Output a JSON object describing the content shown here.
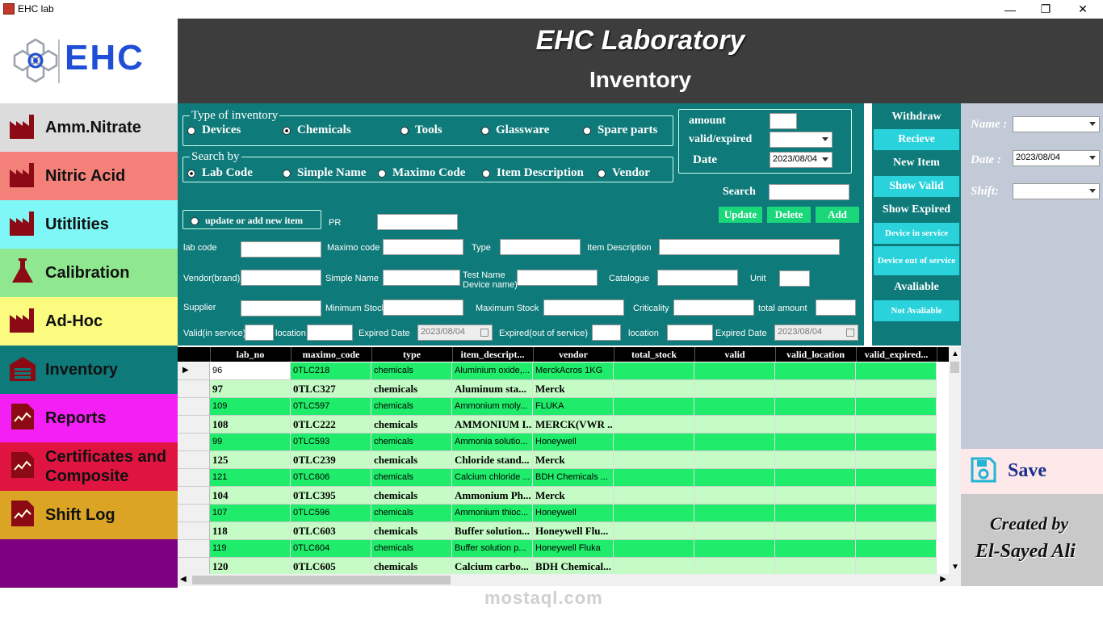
{
  "window": {
    "title": "EHC lab",
    "min": "—",
    "max": "❐",
    "close": "✕"
  },
  "logo": {
    "text": "EHC"
  },
  "sidebar": [
    {
      "label": "Amm.Nitrate",
      "bg": "#dcdcdc",
      "icon": "factory-icon"
    },
    {
      "label": "Nitric Acid",
      "bg": "#f4807a",
      "icon": "factory-icon"
    },
    {
      "label": "Utitlities",
      "bg": "#7ff7f7",
      "icon": "factory-icon"
    },
    {
      "label": "Calibration",
      "bg": "#8fe88f",
      "icon": "flask-icon"
    },
    {
      "label": "Ad-Hoc",
      "bg": "#fbfb80",
      "icon": "factory-icon"
    },
    {
      "label": "Inventory",
      "bg": "#0f7a7a",
      "icon": "warehouse-icon"
    },
    {
      "label": "Reports",
      "bg": "#f41ff4",
      "icon": "report-icon"
    },
    {
      "label": "Certificates and Composite",
      "bg": "#df1440",
      "icon": "report-icon"
    },
    {
      "label": "Shift Log",
      "bg": "#dba424",
      "icon": "report-icon"
    },
    {
      "label": "",
      "bg": "#7d0080",
      "icon": ""
    }
  ],
  "header": {
    "title": "EHC Laboratory",
    "subtitle": "Inventory"
  },
  "type_group": {
    "label": "Type of inventory",
    "options": [
      {
        "label": "Devices",
        "checked": false
      },
      {
        "label": "Chemicals",
        "checked": true
      },
      {
        "label": "Tools",
        "checked": false
      },
      {
        "label": "Glassware",
        "checked": false
      },
      {
        "label": "Spare parts",
        "checked": false
      }
    ]
  },
  "search_group": {
    "label": "Search by",
    "options": [
      {
        "label": "Lab Code",
        "checked": true
      },
      {
        "label": "Simple Name",
        "checked": false
      },
      {
        "label": "Maximo Code",
        "checked": false
      },
      {
        "label": "Item Description",
        "checked": false
      },
      {
        "label": "Vendor",
        "checked": false
      }
    ]
  },
  "amount_box": {
    "amount": "amount",
    "valid_expired": "valid/expired",
    "date": "Date",
    "date_value": "2023/08/04"
  },
  "search": {
    "label": "Search",
    "update": "Update",
    "delete": "Delete",
    "add": "Add"
  },
  "update_radio": "update or add new item",
  "fields": {
    "pr": "PR",
    "lab_code": "lab code",
    "maximo_code": "Maximo code",
    "type": "Type",
    "item_description": "Item Description",
    "vendor": "Vendor(brand)",
    "simple_name": "Simple Name",
    "test_name": "Test Name",
    "device_name": "Device name)",
    "catalogue": "Catalogue",
    "unit": "Unit",
    "supplier": "Supplier",
    "minimum_stock": "Minimum Stock",
    "maximum_stock": "Maximum Stock",
    "criticality": "Criticality",
    "total_amount": "total amount",
    "valid_in_service": "Valid(in service)",
    "location": "location",
    "expired_date": "Expired Date",
    "expired_date_value": "2023/08/04",
    "expired_out": "Expired(out of service)",
    "location2": "location",
    "expired_date2": "Expired Date",
    "expired_date2_value": "2023/08/04"
  },
  "actions": [
    {
      "label": "Withdraw",
      "bg": "#0f7a7a",
      "size": "14px"
    },
    {
      "label": "Recieve",
      "bg": "#2ad3dc",
      "size": "14px"
    },
    {
      "label": "New Item",
      "bg": "#0f7a7a",
      "size": "14px"
    },
    {
      "label": "Show Valid",
      "bg": "#2ad3dc",
      "size": "14px"
    },
    {
      "label": "Show Expired",
      "bg": "#0f7a7a",
      "size": "14px"
    },
    {
      "label": "Device in service",
      "bg": "#2ad3dc",
      "size": "11px"
    },
    {
      "label": "Device out of service",
      "bg": "#2ad3dc",
      "size": "11px"
    },
    {
      "label": "Avaliable",
      "bg": "#0f7a7a",
      "size": "14px"
    },
    {
      "label": "Not Avaliable",
      "bg": "#2ad3dc",
      "size": "11px"
    }
  ],
  "right_panel": {
    "name": "Name :",
    "date": "Date :",
    "date_value": "2023/08/04",
    "shift": "Shift:"
  },
  "save": {
    "label": "Save"
  },
  "credit": {
    "line1": "Created by",
    "line2": "El-Sayed Ali"
  },
  "grid": {
    "columns": [
      "lab_no",
      "maximo_code",
      "type",
      "item_descript...",
      "vendor",
      "total_stock",
      "valid",
      "valid_location",
      "valid_expired..."
    ],
    "rows": [
      [
        "96",
        "0TLC218",
        "chemicals",
        "Aluminium oxide,...",
        "MerckAcros 1KG"
      ],
      [
        "97",
        "0TLC327",
        "chemicals",
        "Aluminum sta...",
        "Merck"
      ],
      [
        "109",
        "0TLC597",
        "chemicals",
        "Ammonium moly...",
        "FLUKA"
      ],
      [
        "108",
        "0TLC222",
        "chemicals",
        "AMMONIUM I...",
        "MERCK(VWR ..."
      ],
      [
        "99",
        "0TLC593",
        "chemicals",
        "Ammonia solutio...",
        "Honeywell"
      ],
      [
        "125",
        "0TLC239",
        "chemicals",
        "Chloride stand...",
        "Merck"
      ],
      [
        "121",
        "0TLC606",
        "chemicals",
        "Calcium chloride ...",
        "BDH Chemicals ..."
      ],
      [
        "104",
        "0TLC395",
        "chemicals",
        "Ammonium Ph...",
        "Merck"
      ],
      [
        "107",
        "0TLC596",
        "chemicals",
        "Ammonium thioc...",
        "Honeywell"
      ],
      [
        "118",
        "0TLC603",
        "chemicals",
        "Buffer solution...",
        "Honeywell Flu..."
      ],
      [
        "119",
        "0TLC604",
        "chemicals",
        "Buffer solution p...",
        "Honeywell Fluka"
      ],
      [
        "120",
        "0TLC605",
        "chemicals",
        "Calcium carbo...",
        "BDH Chemical..."
      ]
    ]
  },
  "watermark": "mostaql.com"
}
